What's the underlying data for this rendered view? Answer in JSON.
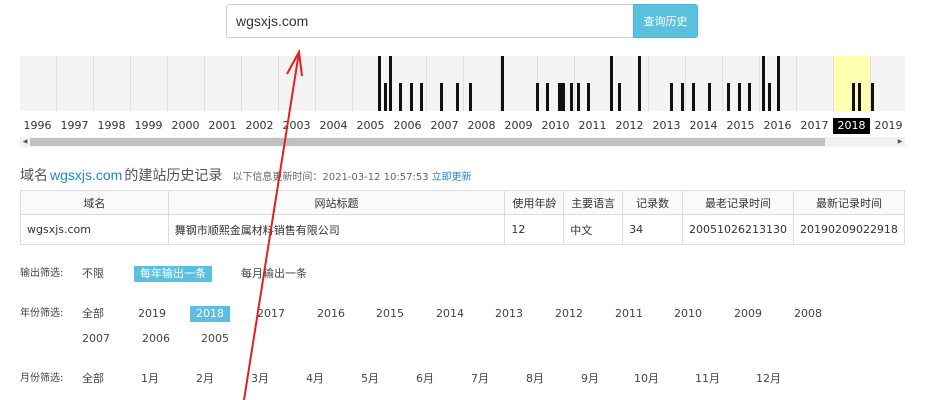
{
  "search": {
    "value": "wgsxjs.com",
    "button_label": "查询历史"
  },
  "timeline": {
    "years": [
      "1996",
      "1997",
      "1998",
      "1999",
      "2000",
      "2001",
      "2002",
      "2003",
      "2004",
      "2005",
      "2006",
      "2007",
      "2008",
      "2009",
      "2010",
      "2011",
      "2012",
      "2013",
      "2014",
      "2015",
      "2016",
      "2017",
      "2018",
      "2019"
    ],
    "selected_year": "2018"
  },
  "heading": {
    "prefix": "域名",
    "domain": "wgsxjs.com",
    "suffix": "的建站历史记录",
    "info": "以下信息更新时间：2021-03-12 10:57:53",
    "update_link": "立即更新"
  },
  "table": {
    "headers": [
      "域名",
      "网站标题",
      "使用年龄",
      "主要语言",
      "记录数",
      "最老记录时间",
      "最新记录时间"
    ],
    "rows": [
      [
        "wgsxjs.com",
        "舞钢市顺熙金属材料销售有限公司",
        "12",
        "中文",
        "34",
        "20051026213130",
        "20190209022918"
      ]
    ]
  },
  "filters": {
    "output": {
      "label": "输出筛选:",
      "options": [
        "不限",
        "每年输出一条",
        "每月输出一条"
      ],
      "active": "每年输出一条"
    },
    "year": {
      "label": "年份筛选:",
      "options": [
        "全部",
        "2019",
        "2018",
        "2017",
        "2016",
        "2015",
        "2014",
        "2013",
        "2012",
        "2011",
        "2010",
        "2009",
        "2008",
        "2007",
        "2006",
        "2005"
      ],
      "active": "2018"
    },
    "month": {
      "label": "月份筛选:",
      "options": [
        "全部",
        "1月",
        "2月",
        "3月",
        "4月",
        "5月",
        "6月",
        "7月",
        "8月",
        "9月",
        "10月",
        "11月",
        "12月"
      ]
    }
  },
  "colors": {
    "accent": "#5bc0de",
    "link": "#1e88c7",
    "selected_year_bg": "#ffffb0",
    "annotation": "#e02020"
  }
}
